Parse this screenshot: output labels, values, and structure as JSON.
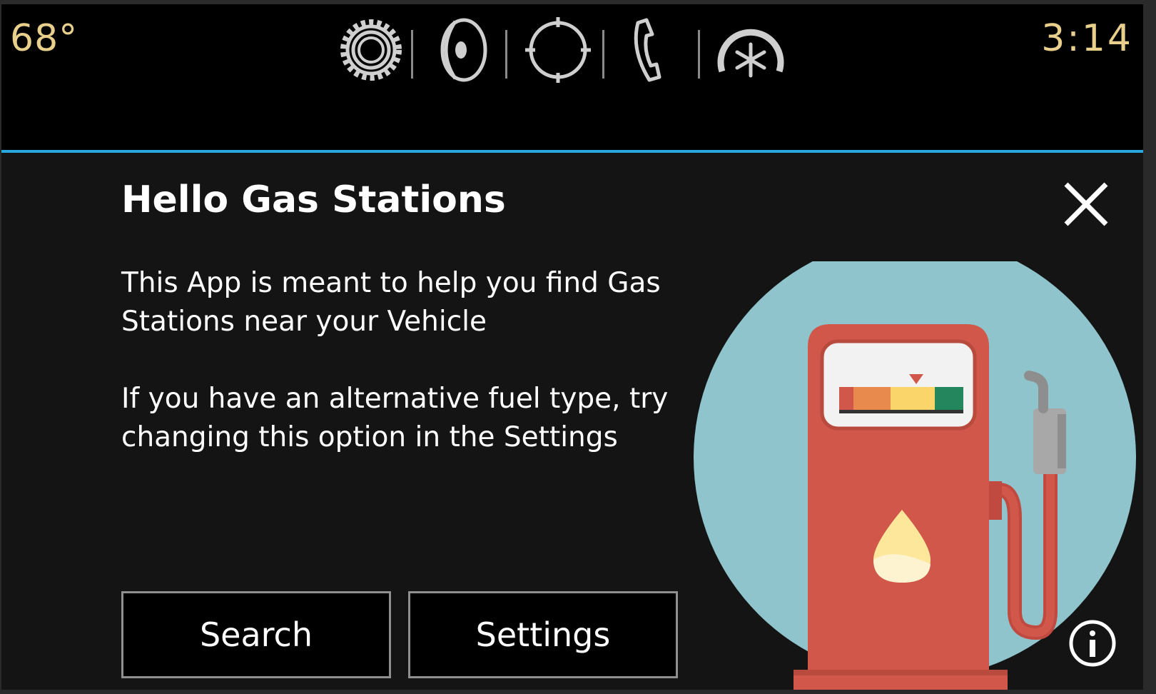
{
  "status_bar": {
    "temperature": "68°",
    "time": "3:14",
    "icons": [
      "settings-gear-icon",
      "audio-icon",
      "navigation-icon",
      "phone-icon",
      "climate-icon"
    ]
  },
  "dialog": {
    "title": "Hello Gas Stations",
    "paragraph_1": "This App is meant to help you find Gas Stations near your Vehicle",
    "paragraph_2": "If you have an alternative fuel type, try changing this option in the Settings",
    "search_label": "Search",
    "settings_label": "Settings"
  },
  "colors": {
    "accent_line": "#29a8dd",
    "status_text": "#e8cf8c",
    "pump_red": "#d0574a",
    "circle_bg": "#8fc4cc"
  }
}
